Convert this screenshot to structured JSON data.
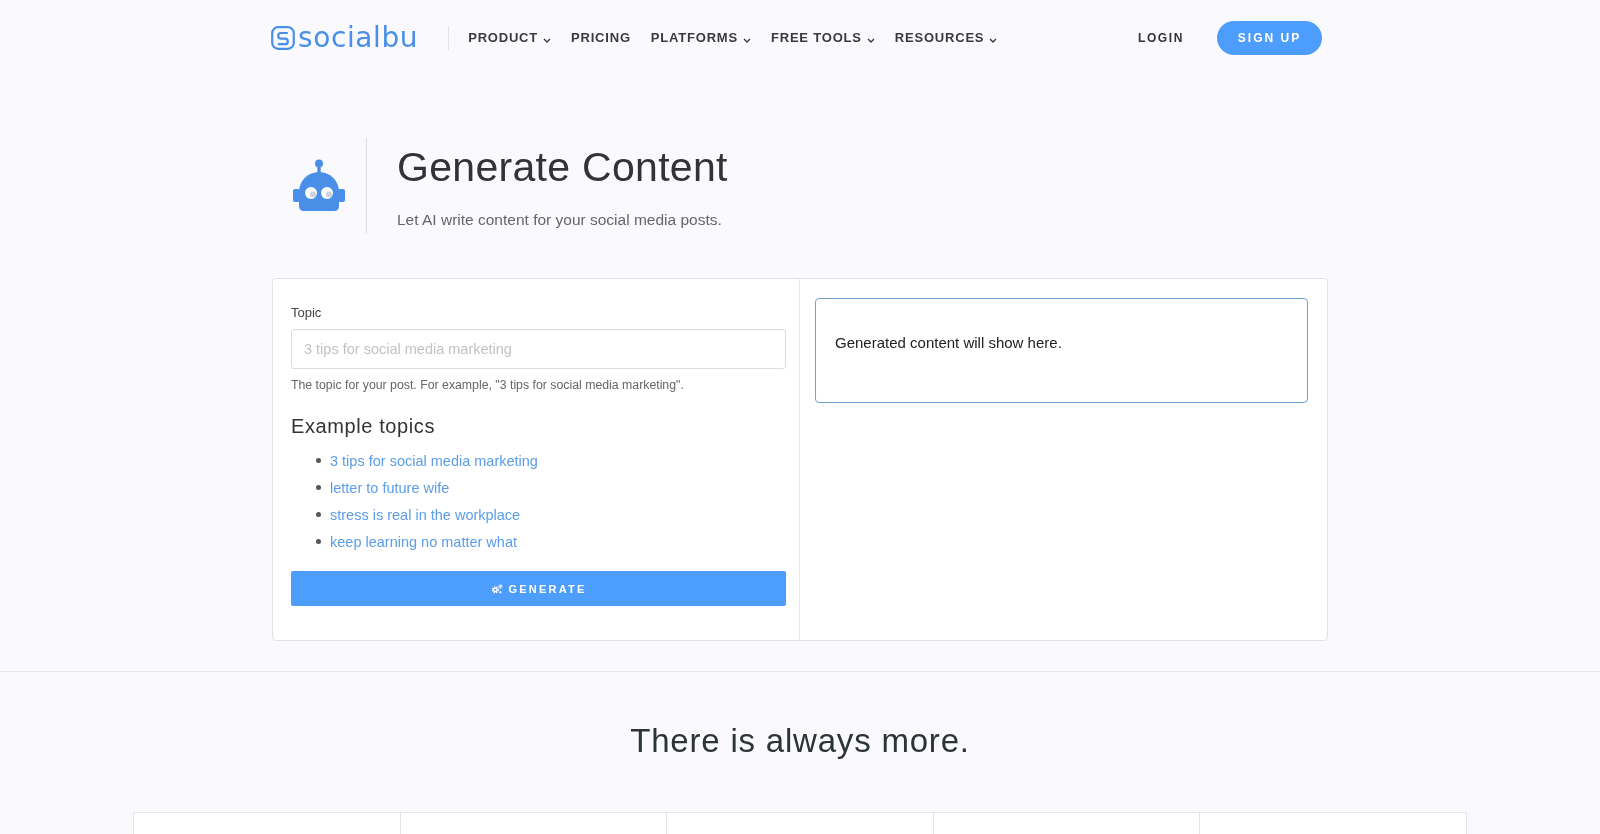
{
  "header": {
    "logo": "socialbu",
    "nav": [
      {
        "label": "PRODUCT",
        "has_menu": true
      },
      {
        "label": "PRICING",
        "has_menu": false
      },
      {
        "label": "PLATFORMS",
        "has_menu": true
      },
      {
        "label": "FREE TOOLS",
        "has_menu": true
      },
      {
        "label": "RESOURCES",
        "has_menu": true
      }
    ],
    "login": "LOGIN",
    "signup": "SIGN UP"
  },
  "hero": {
    "title": "Generate Content",
    "subtitle": "Let AI write content for your social media posts."
  },
  "form": {
    "topic_field": {
      "label": "Topic",
      "placeholder": "3 tips for social media marketing",
      "help": "The topic for your post. For example, \"3 tips for social media marketing\"."
    },
    "examples": {
      "heading": "Example topics",
      "items": [
        "3 tips for social media marketing",
        "letter to future wife",
        "stress is real in the workplace",
        "keep learning no matter what"
      ]
    },
    "generate_button": "GENERATE"
  },
  "output": {
    "text": "Generated content will show here."
  },
  "more_section": {
    "heading": "There is always more."
  }
}
